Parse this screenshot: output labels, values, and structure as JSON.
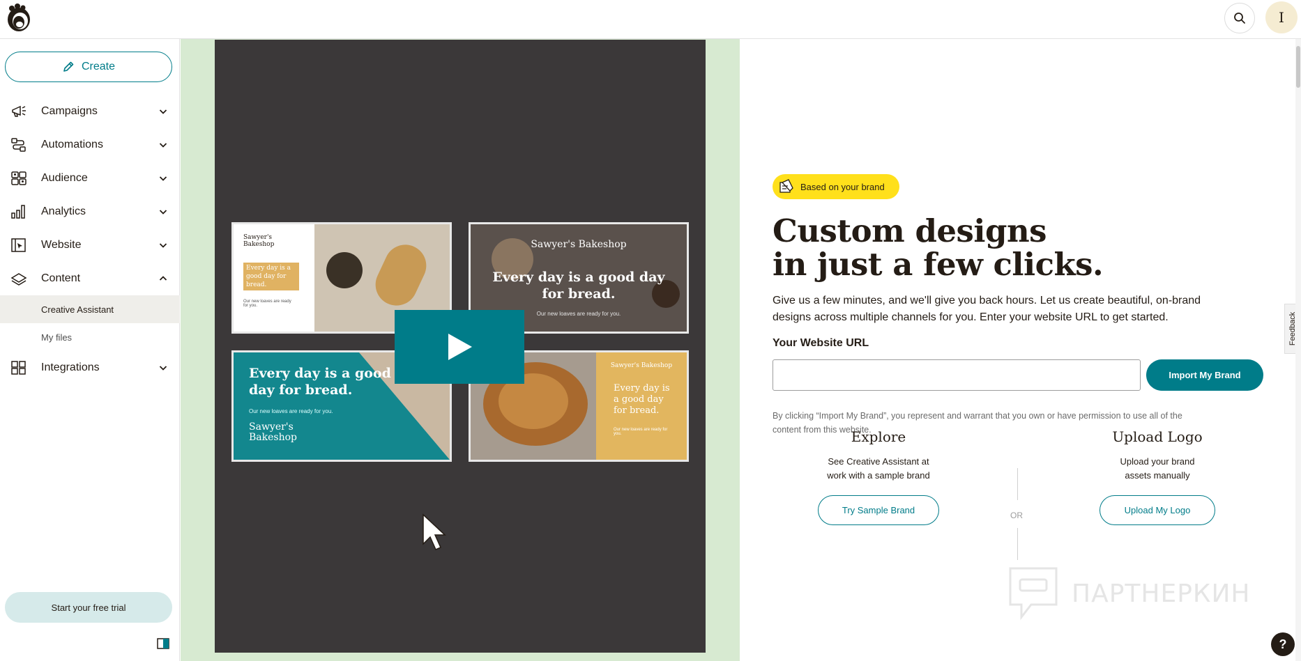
{
  "header": {
    "logo_icon": "freddie-logo-icon",
    "search_icon": "search-icon",
    "avatar_initial": "I"
  },
  "sidebar": {
    "create_label": "Create",
    "items": [
      {
        "label": "Campaigns",
        "icon": "megaphone-icon",
        "expanded": false
      },
      {
        "label": "Automations",
        "icon": "automations-icon",
        "expanded": false
      },
      {
        "label": "Audience",
        "icon": "audience-icon",
        "expanded": false
      },
      {
        "label": "Analytics",
        "icon": "bar-chart-icon",
        "expanded": false
      },
      {
        "label": "Website",
        "icon": "website-icon",
        "expanded": false
      },
      {
        "label": "Content",
        "icon": "content-icon",
        "expanded": true
      },
      {
        "label": "Integrations",
        "icon": "grid-icon",
        "expanded": false
      }
    ],
    "content_subitems": [
      {
        "label": "Creative Assistant",
        "active": true
      },
      {
        "label": "My files",
        "active": false
      }
    ],
    "trial_label": "Start your free trial"
  },
  "video": {
    "tiles": [
      {
        "brand": "Sawyer's Bakeshop",
        "headline": "Every day is a good day for bread.",
        "sub": "Our new loaves are ready for you."
      },
      {
        "brand": "Sawyer's Bakeshop",
        "headline": "Every day is a good day for bread.",
        "sub": "Our new loaves are ready for you."
      },
      {
        "brand": "Sawyer's Bakeshop",
        "headline": "Every day is a good day for bread.",
        "sub": "Our new loaves are ready for you."
      },
      {
        "brand": "Sawyer's Bakeshop",
        "headline": "Every day is a good day for bread.",
        "sub": "Our new loaves are ready for you."
      }
    ],
    "play_icon": "play-icon"
  },
  "main": {
    "badge": "Based on your brand",
    "headline_line1": "Custom designs",
    "headline_line2": "in just a few clicks.",
    "description": "Give us a few minutes, and we'll give you back hours. Let us create beautiful, on-brand designs across multiple channels for you. Enter your website URL to get started.",
    "url_label": "Your Website URL",
    "url_value": "",
    "import_button": "Import My Brand",
    "disclaimer": "By clicking “Import My Brand”, you represent and warrant that you own or have permission to use all of the content from this website.",
    "explore": {
      "title": "Explore",
      "description": "See Creative Assistant at work with a sample brand",
      "button": "Try Sample Brand"
    },
    "or_label": "OR",
    "upload": {
      "title": "Upload Logo",
      "description": "Upload your brand assets manually",
      "button": "Upload My Logo"
    },
    "watermark": "ПАРТНЕРКИН",
    "feedback_label": "Feedback",
    "help_label": "?"
  },
  "colors": {
    "accent": "#007c89",
    "badge": "#ffe01b",
    "video_bg": "#3b3839",
    "video_frame": "#d7ead1"
  }
}
